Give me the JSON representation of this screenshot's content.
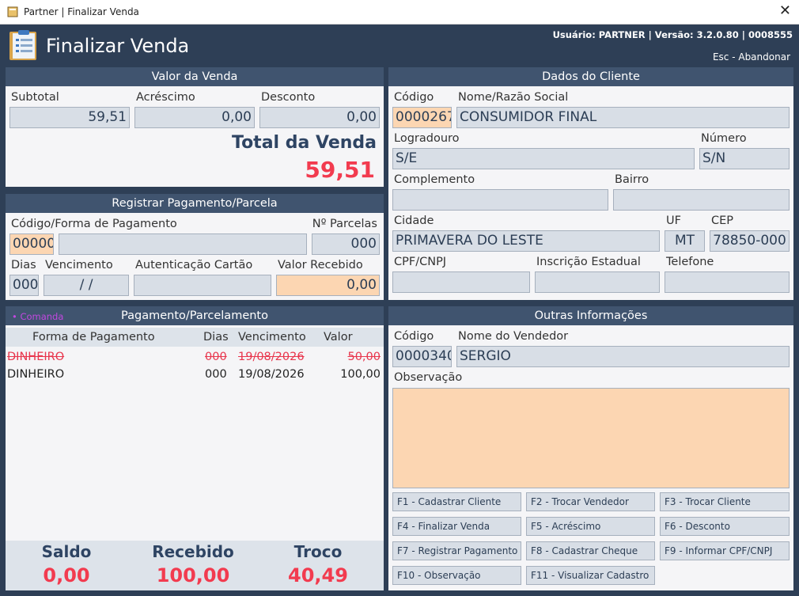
{
  "window": {
    "title": "Partner | Finalizar Venda",
    "close": "✕"
  },
  "header": {
    "title": "Finalizar Venda",
    "user_info": "Usuário: PARTNER | Versão: 3.2.0.80 | 0008555",
    "esc": "Esc - Abandonar"
  },
  "valor_venda": {
    "title": "Valor da Venda",
    "subtotal_label": "Subtotal",
    "subtotal": "59,51",
    "acrescimo_label": "Acréscimo",
    "acrescimo": "0,00",
    "desconto_label": "Desconto",
    "desconto": "0,00",
    "total_label": "Total da Venda",
    "total": "59,51"
  },
  "registrar": {
    "title": "Registrar Pagamento/Parcela",
    "codigo_label": "Código/Forma de Pagamento",
    "codigo": "00000",
    "forma": "",
    "parcelas_label": "Nº Parcelas",
    "parcelas": "000",
    "dias_label": "Dias",
    "dias": "000",
    "vencimento_label": "Vencimento",
    "vencimento": "/  /",
    "autenticacao_label": "Autenticação Cartão",
    "autenticacao": "",
    "valor_recebido_label": "Valor Recebido",
    "valor_recebido": "0,00"
  },
  "pagamentos": {
    "comanda": "• Comanda",
    "title": "Pagamento/Parcelamento",
    "columns": [
      "Forma de Pagamento",
      "Dias",
      "Vencimento",
      "Valor"
    ],
    "rows": [
      {
        "forma": "DINHEIRO",
        "dias": "000",
        "vencimento": "19/08/2026",
        "valor": "50,00",
        "cancelled": true
      },
      {
        "forma": "DINHEIRO",
        "dias": "000",
        "vencimento": "19/08/2026",
        "valor": "100,00",
        "cancelled": false
      }
    ],
    "saldo_label": "Saldo",
    "saldo": "0,00",
    "recebido_label": "Recebido",
    "recebido": "100,00",
    "troco_label": "Troco",
    "troco": "40,49"
  },
  "cliente": {
    "title": "Dados do Cliente",
    "codigo_label": "Código",
    "codigo": "0000267",
    "nome_label": "Nome/Razão Social",
    "nome": "CONSUMIDOR FINAL",
    "logradouro_label": "Logradouro",
    "logradouro": "S/E",
    "numero_label": "Número",
    "numero": "S/N",
    "complemento_label": "Complemento",
    "complemento": "",
    "bairro_label": "Bairro",
    "bairro": "",
    "cidade_label": "Cidade",
    "cidade": "PRIMAVERA DO LESTE",
    "uf_label": "UF",
    "uf": "MT",
    "cep_label": "CEP",
    "cep": "78850-000",
    "cpf_label": "CPF/CNPJ",
    "cpf": "",
    "ie_label": "Inscrição Estadual",
    "ie": "",
    "telefone_label": "Telefone",
    "telefone": ""
  },
  "outras": {
    "title": "Outras Informações",
    "codigo_label": "Código",
    "codigo": "0000340",
    "vendedor_label": "Nome do Vendedor",
    "vendedor": "SERGIO",
    "obs_label": "Observação",
    "obs": ""
  },
  "fkeys": [
    "F1 - Cadastrar Cliente",
    "F2 - Trocar Vendedor",
    "F3 - Trocar Cliente",
    "F4 - Finalizar Venda",
    "F5 - Acréscimo",
    "F6 - Desconto",
    "F7 - Registrar Pagamento",
    "F8 - Cadastrar Cheque",
    "F9 - Informar CPF/CNPJ",
    "F10 - Observação",
    "F11 - Visualizar Cadastro"
  ],
  "colors": {
    "accent_red": "#f23b4f",
    "navy": "#2e4463",
    "orange_field": "#fcd6b2",
    "comanda": "#c248e0"
  }
}
